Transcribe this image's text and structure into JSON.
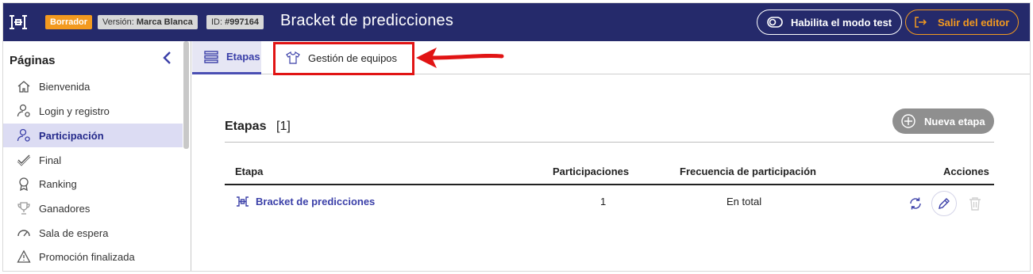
{
  "header": {
    "badge_draft": "Borrador",
    "badge_version_label": "Versión:",
    "badge_version_value": "Marca Blanca",
    "badge_id_label": "ID:",
    "badge_id_value": "#997164",
    "title": "Bracket de predicciones",
    "test_mode_label": "Habilita el modo test",
    "exit_label": "Salir del editor"
  },
  "sidebar": {
    "title": "Páginas",
    "items": [
      {
        "label": "Bienvenida",
        "icon": "home-icon"
      },
      {
        "label": "Login y registro",
        "icon": "user-gear-icon"
      },
      {
        "label": "Participación",
        "icon": "user-gear-icon",
        "active": true
      },
      {
        "label": "Final",
        "icon": "check-icon"
      },
      {
        "label": "Ranking",
        "icon": "medal-icon"
      },
      {
        "label": "Ganadores",
        "icon": "trophy-icon"
      },
      {
        "label": "Sala de espera",
        "icon": "gauge-icon"
      },
      {
        "label": "Promoción finalizada",
        "icon": "warning-icon"
      }
    ]
  },
  "tabs": [
    {
      "label": "Etapas",
      "icon": "list-icon",
      "active": true
    },
    {
      "label": "Gestión de equipos",
      "icon": "shirt-icon",
      "active": false
    }
  ],
  "main": {
    "section_title": "Etapas",
    "section_count": "[1]",
    "new_button": "Nueva etapa",
    "columns": [
      "Etapa",
      "Participaciones",
      "Frecuencia de participación",
      "Acciones"
    ],
    "rows": [
      {
        "stage": "Bracket de predicciones",
        "participations": "1",
        "frequency": "En total"
      }
    ]
  },
  "colors": {
    "header_bg": "#252a6b",
    "accent_orange": "#f39a1f",
    "accent_blue": "#3a3fa8",
    "highlight_red": "#e11414"
  }
}
